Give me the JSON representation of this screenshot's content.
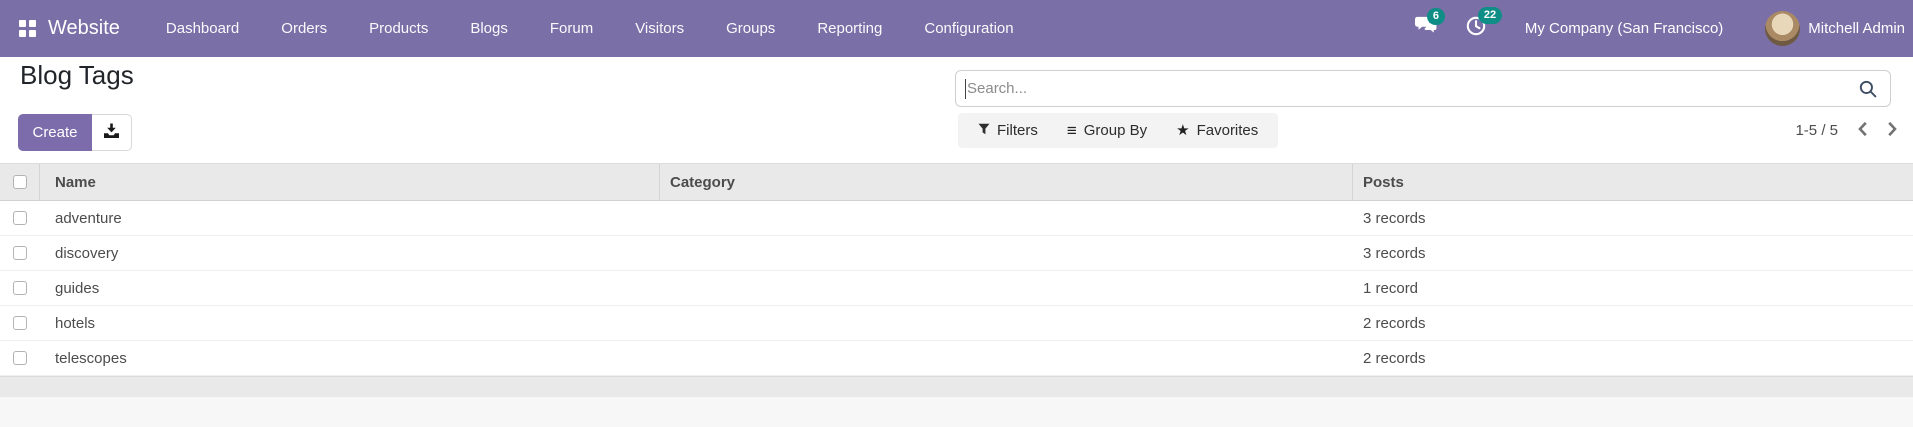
{
  "theme": {
    "navbar_bg": "#7a6fa6",
    "primary_btn": "#7d6cab",
    "badge_bg": "#0f8e88",
    "header_bg": "#e9e9e9"
  },
  "navbar": {
    "brand": "Website",
    "menu": [
      "Dashboard",
      "Orders",
      "Products",
      "Blogs",
      "Forum",
      "Visitors",
      "Groups",
      "Reporting",
      "Configuration"
    ],
    "messages_count": "6",
    "activities_count": "22",
    "company": "My Company (San Francisco)",
    "user_name": "Mitchell Admin"
  },
  "page": {
    "title": "Blog Tags",
    "create_button": "Create",
    "search_placeholder": "Search...",
    "filters_label": "Filters",
    "group_by_label": "Group By",
    "favorites_label": "Favorites",
    "pager_range": "1-5 / 5"
  },
  "icons": {
    "group_by_glyph": "≡",
    "favorites_glyph": "★"
  },
  "table": {
    "headers": {
      "name": "Name",
      "category": "Category",
      "posts": "Posts"
    },
    "rows": [
      {
        "name": "adventure",
        "category": "",
        "posts": "3 records",
        "checked": false
      },
      {
        "name": "discovery",
        "category": "",
        "posts": "3 records",
        "checked": false
      },
      {
        "name": "guides",
        "category": "",
        "posts": "1 record",
        "checked": false
      },
      {
        "name": "hotels",
        "category": "",
        "posts": "2 records",
        "checked": false
      },
      {
        "name": "telescopes",
        "category": "",
        "posts": "2 records",
        "checked": false
      }
    ]
  }
}
